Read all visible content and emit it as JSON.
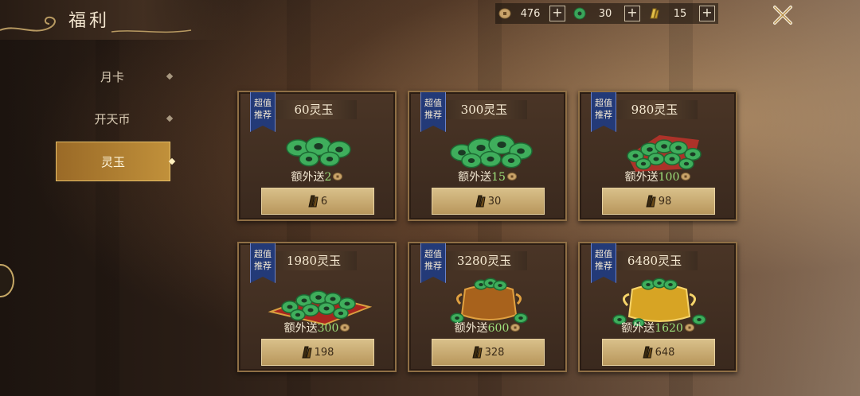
{
  "window": {
    "title": "福利"
  },
  "resources": [
    {
      "icon": "copper-coin-icon",
      "value": "476"
    },
    {
      "icon": "jade-icon",
      "value": "30"
    },
    {
      "icon": "gold-ingot-icon",
      "value": "15"
    }
  ],
  "sidebar": {
    "items": [
      {
        "label": "月卡",
        "active": false
      },
      {
        "label": "开天币",
        "active": false
      },
      {
        "label": "灵玉",
        "active": true
      }
    ]
  },
  "ribbon": {
    "line1": "超值",
    "line2": "推荐"
  },
  "bonus_prefix": "额外送",
  "cards": [
    {
      "title": "60灵玉",
      "bonus": "2",
      "price": "6",
      "art": "jade-coins-small-icon"
    },
    {
      "title": "300灵玉",
      "bonus": "15",
      "price": "30",
      "art": "jade-coins-pile-icon"
    },
    {
      "title": "980灵玉",
      "bonus": "100",
      "price": "98",
      "art": "jade-coins-on-cloth-icon"
    },
    {
      "title": "1980灵玉",
      "bonus": "300",
      "price": "198",
      "art": "jade-coins-tray-icon"
    },
    {
      "title": "3280灵玉",
      "bonus": "600",
      "price": "328",
      "art": "jade-bronze-pot-icon"
    },
    {
      "title": "6480灵玉",
      "bonus": "1620",
      "price": "648",
      "art": "jade-gold-pot-icon"
    }
  ],
  "colors": {
    "accent_gold": "#d9c08a",
    "bonus_green": "#9de07a",
    "ribbon_blue": "#233a78"
  }
}
